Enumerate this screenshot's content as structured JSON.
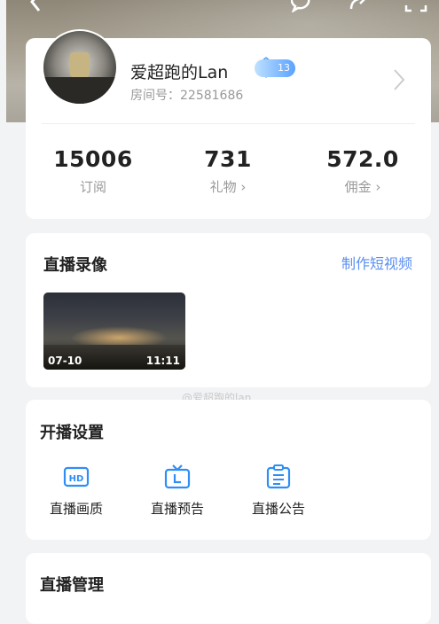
{
  "profile": {
    "username": "爱超跑的Lan",
    "level": "13",
    "room_id": "房间号：22581686",
    "stats": [
      {
        "value": "15006",
        "label": "订阅"
      },
      {
        "value": "731",
        "label": "礼物 ›"
      },
      {
        "value": "572.0",
        "label": "佣金 ›"
      }
    ]
  },
  "recordings": {
    "title": "直播录像",
    "make_short_video": "制作短视频",
    "items": [
      {
        "date": "07-10",
        "time": "11:11"
      }
    ]
  },
  "watermark": "@爱超跑的lan",
  "settings": {
    "title": "开播设置",
    "items": [
      {
        "label": "直播画质",
        "icon": "hd-icon"
      },
      {
        "label": "直播预告",
        "icon": "tv-icon"
      },
      {
        "label": "直播公告",
        "icon": "announcement-icon"
      }
    ]
  },
  "manage": {
    "title": "直播管理"
  },
  "colors": {
    "accent": "#5b8ff0",
    "icon_blue": "#2f8ef5"
  }
}
